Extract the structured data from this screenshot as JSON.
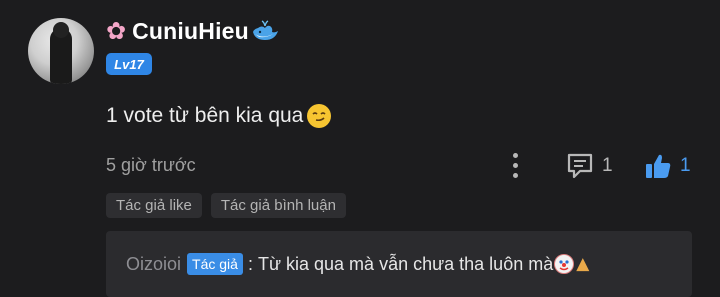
{
  "user": {
    "name_prefix_icon": "cherry-blossom-icon",
    "name": "CuniuHieu",
    "name_suffix_icon": "whale-icon",
    "level": "Lv17"
  },
  "comment": {
    "text": "1 vote từ bên kia qua",
    "emoji": "smirking-face-icon"
  },
  "meta": {
    "time": "5 giờ trước",
    "reply_count": "1",
    "like_count": "1"
  },
  "tags": [
    "Tác giả like",
    "Tác giả bình luận"
  ],
  "reply": {
    "author": "Oizoioi",
    "author_badge": "Tác giả",
    "separator": ":",
    "text": "Từ kia qua mà vẫn chưa tha luôn mà",
    "emojis": [
      "clown-face-icon",
      "folded-hands-icon"
    ]
  },
  "colors": {
    "background": "#1c1c1e",
    "accent_blue": "#2f86e6",
    "tag_bg": "#2e2e31",
    "reply_bg": "#2b2b2e"
  }
}
